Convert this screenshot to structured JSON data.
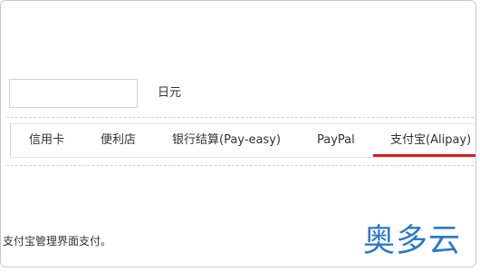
{
  "amount": {
    "value": "",
    "placeholder": "",
    "currency": "日元"
  },
  "payment_tabs": {
    "items": [
      {
        "label": "信用卡"
      },
      {
        "label": "便利店"
      },
      {
        "label": "银行结算(Pay-easy)"
      },
      {
        "label": "PayPal"
      },
      {
        "label": "支付宝(Alipay)"
      }
    ],
    "selected": "支付宝(Alipay)",
    "accent_color": "#d8201f"
  },
  "note": {
    "text": "支付宝管理界面支付。"
  },
  "watermark": {
    "text": "奥多云",
    "color": "#2a79c9"
  }
}
